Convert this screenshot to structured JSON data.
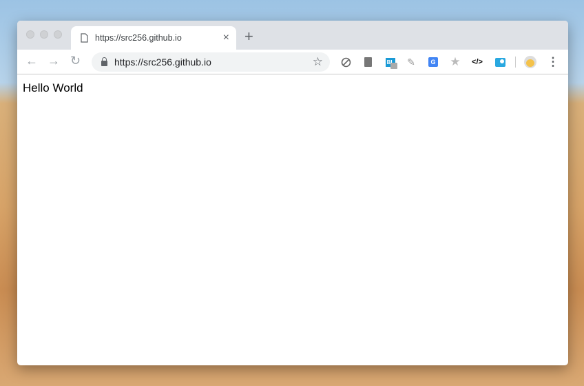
{
  "tab": {
    "title": "https://src256.github.io",
    "close": "×",
    "new_tab": "+"
  },
  "omnibox": {
    "url": "https://src256.github.io",
    "star": "☆"
  },
  "nav": {
    "back": "←",
    "forward": "→",
    "reload": "↻"
  },
  "extensions": {
    "code_label": "</>",
    "bl_label": "BL",
    "menu": "⋮"
  },
  "page": {
    "text": "Hello World"
  }
}
